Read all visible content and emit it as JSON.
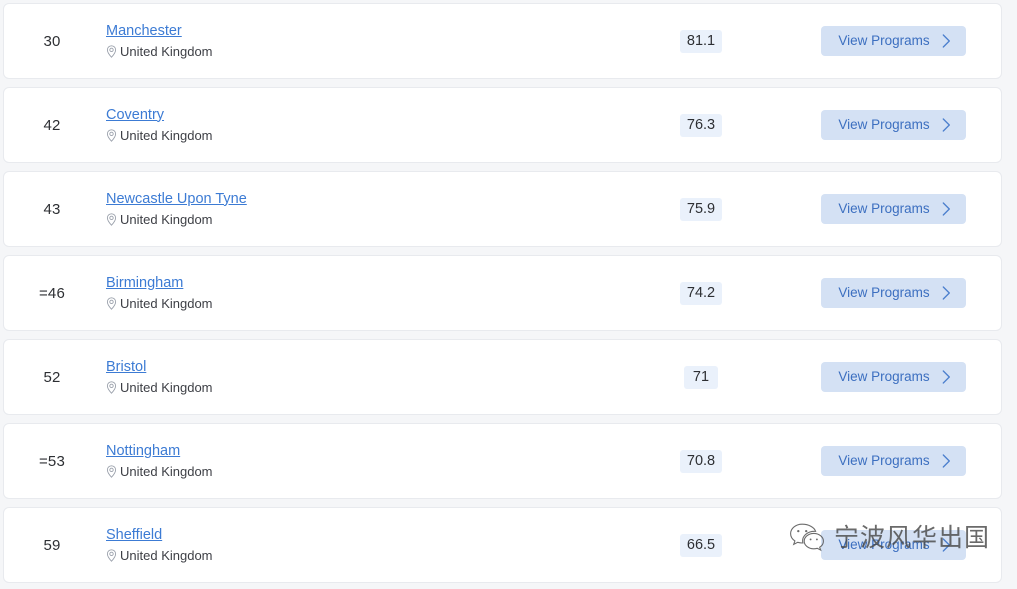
{
  "list": {
    "location_icon": "map-pin-icon",
    "chevron_icon": "chevron-right-icon",
    "action_label": "View Programs",
    "colors": {
      "link": "#3c7bd4",
      "badge_bg": "#eaf1fb",
      "button_bg": "#d4e1f4",
      "button_text": "#3c6fc0",
      "page_bg": "#f5f6f8",
      "card_bg": "#ffffff"
    },
    "rows": [
      {
        "rank": "30",
        "name": "Manchester",
        "country": "United Kingdom",
        "score": "81.1",
        "action": "View Programs"
      },
      {
        "rank": "42",
        "name": "Coventry",
        "country": "United Kingdom",
        "score": "76.3",
        "action": "View Programs"
      },
      {
        "rank": "43",
        "name": "Newcastle Upon Tyne",
        "country": "United Kingdom",
        "score": "75.9",
        "action": "View Programs"
      },
      {
        "rank": "=46",
        "name": "Birmingham",
        "country": "United Kingdom",
        "score": "74.2",
        "action": "View Programs"
      },
      {
        "rank": "52",
        "name": "Bristol",
        "country": "United Kingdom",
        "score": "71",
        "action": "View Programs"
      },
      {
        "rank": "=53",
        "name": "Nottingham",
        "country": "United Kingdom",
        "score": "70.8",
        "action": "View Programs"
      },
      {
        "rank": "59",
        "name": "Sheffield",
        "country": "United Kingdom",
        "score": "66.5",
        "action": "View Programs"
      }
    ]
  },
  "watermark": {
    "icon": "wechat-icon",
    "text": "宁波风华出国"
  }
}
